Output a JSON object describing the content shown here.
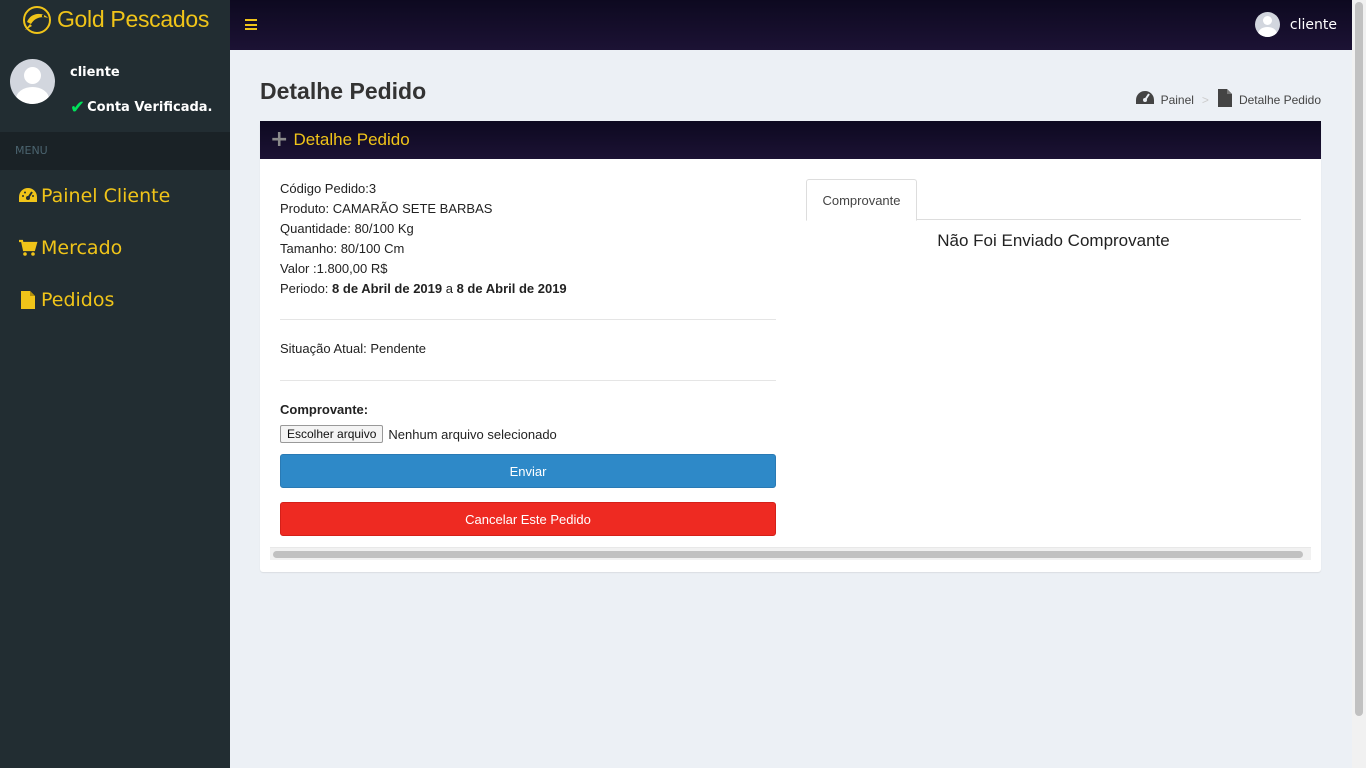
{
  "brand": {
    "logo_text": "Gold Pescados",
    "accent_color": "#f0c419"
  },
  "sidebar": {
    "user_name": "cliente",
    "user_status": "Conta Verificada.",
    "menu_header": "MENU",
    "items": [
      {
        "label": "Painel Cliente",
        "icon": "dashboard-icon"
      },
      {
        "label": "Mercado",
        "icon": "shopping-cart-icon"
      },
      {
        "label": "Pedidos",
        "icon": "file-icon"
      }
    ]
  },
  "topbar": {
    "user_name": "cliente"
  },
  "page": {
    "title": "Detalhe Pedido",
    "breadcrumb": [
      {
        "label": "Painel",
        "icon": "dashboard-icon"
      },
      {
        "label": "Detalhe Pedido",
        "icon": "file-icon"
      }
    ]
  },
  "box": {
    "title": "Detalhe Pedido",
    "order": {
      "codigo": "Código Pedido:3",
      "produto": "Produto: CAMARÃO SETE BARBAS",
      "quantidade": "Quantidade: 80/100 Kg",
      "tamanho": "Tamanho: 80/100 Cm",
      "valor": "Valor :1.800,00 R$",
      "periodo_label": "Periodo: ",
      "periodo_start": "8 de Abril de 2019",
      "periodo_sep": " a ",
      "periodo_end": "8 de Abril de 2019"
    },
    "situacao": "Situação Atual: Pendente",
    "comprovante_label": "Comprovante:",
    "file_button": "Escolher arquivo",
    "file_status": "Nenhum arquivo selecionado",
    "enviar_button": "Enviar",
    "cancelar_button": "Cancelar Este Pedido",
    "tab_label": "Comprovante",
    "tab_message": "Não Foi Enviado Comprovante"
  }
}
